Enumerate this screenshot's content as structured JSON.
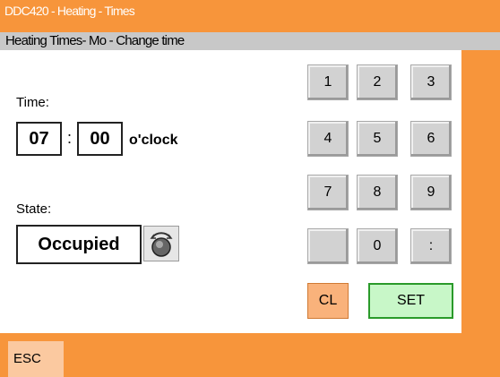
{
  "window": {
    "title": "DDC420 - Heating - Times"
  },
  "header": {
    "subtitle": "Heating Times- Mo - Change time"
  },
  "time": {
    "label": "Time:",
    "hours": "07",
    "separator": ":",
    "minutes": "00",
    "unit": "o'clock"
  },
  "state": {
    "label": "State:",
    "value": "Occupied",
    "knob_icon": "rotary-knob-icon"
  },
  "keypad": {
    "keys": [
      "1",
      "2",
      "3",
      "4",
      "5",
      "6",
      "7",
      "8",
      "9",
      "",
      "0",
      ":"
    ],
    "clear_label": "CL",
    "set_label": "SET"
  },
  "footer": {
    "esc_label": "ESC"
  },
  "colors": {
    "frame": "#f7953b",
    "subtitle_bar": "#c8c8c8",
    "set_button": "#c8f7c8",
    "cl_button": "#f9b27b",
    "esc_button": "#fbc9a0"
  }
}
